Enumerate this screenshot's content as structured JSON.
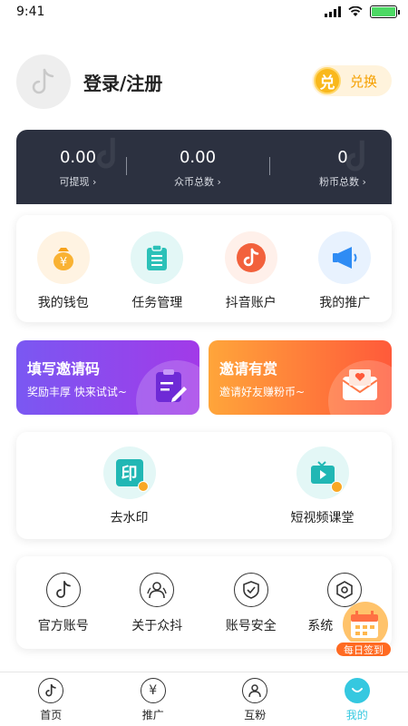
{
  "status": {
    "time": "9:41"
  },
  "profile": {
    "login_label": "登录/注册",
    "redeem_coin": "兑",
    "redeem_label": "兑换"
  },
  "balance": [
    {
      "value": "0.00",
      "label": "可提现 ›"
    },
    {
      "value": "0.00",
      "label": "众币总数 ›"
    },
    {
      "value": "0",
      "label": "粉币总数 ›"
    }
  ],
  "quick": [
    {
      "label": "我的钱包",
      "icon": "wallet-icon"
    },
    {
      "label": "任务管理",
      "icon": "clipboard-icon"
    },
    {
      "label": "抖音账户",
      "icon": "tiktok-icon"
    },
    {
      "label": "我的推广",
      "icon": "megaphone-icon"
    }
  ],
  "banners": {
    "left": {
      "title": "填写邀请码",
      "subtitle": "奖励丰厚  快来试试~"
    },
    "right": {
      "title": "邀请有赏",
      "subtitle": "邀请好友赚粉币~"
    }
  },
  "tools": [
    {
      "label": "去水印",
      "icon": "watermark-icon",
      "glyph": "印"
    },
    {
      "label": "短视频课堂",
      "icon": "video-class-icon"
    }
  ],
  "settings": [
    {
      "label": "官方账号",
      "icon": "tiktok-icon"
    },
    {
      "label": "关于众抖",
      "icon": "people-icon"
    },
    {
      "label": "账号安全",
      "icon": "shield-icon"
    },
    {
      "label": "系统",
      "icon": "settings-icon"
    }
  ],
  "sign_in": {
    "label": "每日签到"
  },
  "tabs": [
    {
      "label": "首页"
    },
    {
      "label": "推广"
    },
    {
      "label": "互粉"
    },
    {
      "label": "我的",
      "active": true
    }
  ],
  "colors": {
    "accent": "#35c8e0",
    "gold": "#f5a000",
    "dark": "#2c3140"
  }
}
